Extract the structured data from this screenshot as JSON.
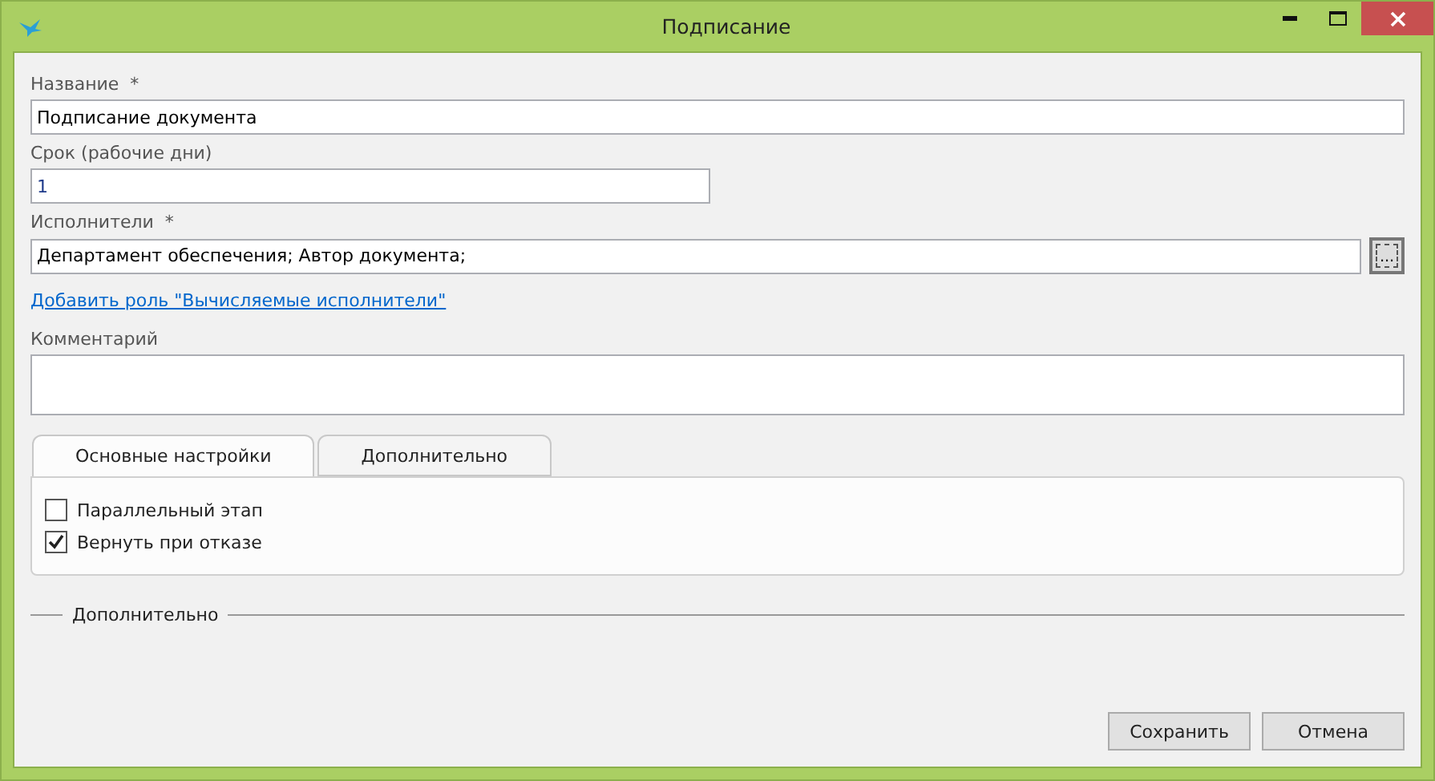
{
  "window": {
    "title": "Подписание",
    "window_buttons": [
      {
        "kind": "minimize"
      },
      {
        "kind": "maximize"
      },
      {
        "kind": "close"
      }
    ]
  },
  "fields": [
    {
      "label": "Название  *",
      "value": "Подписание документа",
      "kind": "wide"
    },
    {
      "label": "Срок (рабочие дни)",
      "value": "1",
      "kind": "half"
    },
    {
      "label": "Исполнители  *",
      "value": "Департамент обеспечения; Автор документа;",
      "kind": "picker",
      "button": "..."
    }
  ],
  "link": "Добавить роль \"Вычисляемые исполнители\"",
  "comment": {
    "label": "Комментарий"
  },
  "tabs": [
    {
      "label": "Основные настройки",
      "selected": true
    },
    {
      "label": "Дополнительно",
      "selected": false
    }
  ],
  "options": [
    {
      "label": "Параллельный этап",
      "checked": false
    },
    {
      "label": "Вернуть при отказе",
      "checked": true
    }
  ],
  "group": {
    "title": "Дополнительно"
  },
  "buttons": [
    "Сохранить",
    "Отмена"
  ]
}
